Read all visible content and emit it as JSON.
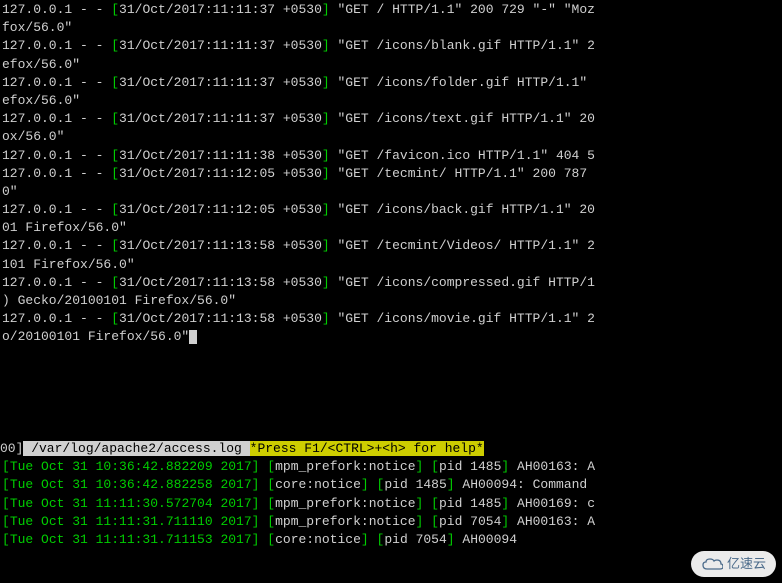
{
  "access_log": [
    {
      "ip": "127.0.0.1",
      "ts": "31/Oct/2017:11:11:37 +0530",
      "req": "\"GET / HTTP/1.1\" 200 729 \"-\" \"Moz",
      "cont": "fox/56.0\""
    },
    {
      "ip": "127.0.0.1",
      "ts": "31/Oct/2017:11:11:37 +0530",
      "req": "\"GET /icons/blank.gif HTTP/1.1\" 2",
      "cont": "efox/56.0\""
    },
    {
      "ip": "127.0.0.1",
      "ts": "31/Oct/2017:11:11:37 +0530",
      "req": "\"GET /icons/folder.gif HTTP/1.1\" ",
      "cont": "efox/56.0\""
    },
    {
      "ip": "127.0.0.1",
      "ts": "31/Oct/2017:11:11:37 +0530",
      "req": "\"GET /icons/text.gif HTTP/1.1\" 20",
      "cont": "ox/56.0\""
    },
    {
      "ip": "127.0.0.1",
      "ts": "31/Oct/2017:11:11:38 +0530",
      "req": "\"GET /favicon.ico HTTP/1.1\" 404 5",
      "cont": ""
    },
    {
      "ip": "127.0.0.1",
      "ts": "31/Oct/2017:11:12:05 +0530",
      "req": "\"GET /tecmint/ HTTP/1.1\" 200 787 ",
      "cont": "0\""
    },
    {
      "ip": "127.0.0.1",
      "ts": "31/Oct/2017:11:12:05 +0530",
      "req": "\"GET /icons/back.gif HTTP/1.1\" 20",
      "cont": "01 Firefox/56.0\""
    },
    {
      "ip": "127.0.0.1",
      "ts": "31/Oct/2017:11:13:58 +0530",
      "req": "\"GET /tecmint/Videos/ HTTP/1.1\" 2",
      "cont": "101 Firefox/56.0\""
    },
    {
      "ip": "127.0.0.1",
      "ts": "31/Oct/2017:11:13:58 +0530",
      "req": "\"GET /icons/compressed.gif HTTP/1",
      "cont": ") Gecko/20100101 Firefox/56.0\""
    },
    {
      "ip": "127.0.0.1",
      "ts": "31/Oct/2017:11:13:58 +0530",
      "req": "\"GET /icons/movie.gif HTTP/1.1\" 2",
      "cont": "o/20100101 Firefox/56.0\"",
      "cursor": true
    }
  ],
  "status": {
    "prefix": "00]",
    "path": " /var/log/apache2/access.log ",
    "help": "*Press F1/<CTRL>+<h> for help*"
  },
  "error_log": [
    {
      "ts": "Tue Oct 31 10:36:42.882209 2017",
      "module": "mpm_prefork:notice",
      "pid": "pid 1485",
      "code": "AH00163: A"
    },
    {
      "ts": "Tue Oct 31 10:36:42.882258 2017",
      "module": "core:notice",
      "pid": "pid 1485",
      "code": "AH00094: Command "
    },
    {
      "ts": "Tue Oct 31 11:11:30.572704 2017",
      "module": "mpm_prefork:notice",
      "pid": "pid 1485",
      "code": "AH00169: c"
    },
    {
      "ts": "Tue Oct 31 11:11:31.711110 2017",
      "module": "mpm_prefork:notice",
      "pid": "pid 7054",
      "code": "AH00163: A"
    },
    {
      "ts": "Tue Oct 31 11:11:31.711153 2017",
      "module": "core:notice",
      "pid": "pid 7054",
      "code": "AH00094       "
    }
  ],
  "watermark": {
    "text": "亿速云"
  }
}
